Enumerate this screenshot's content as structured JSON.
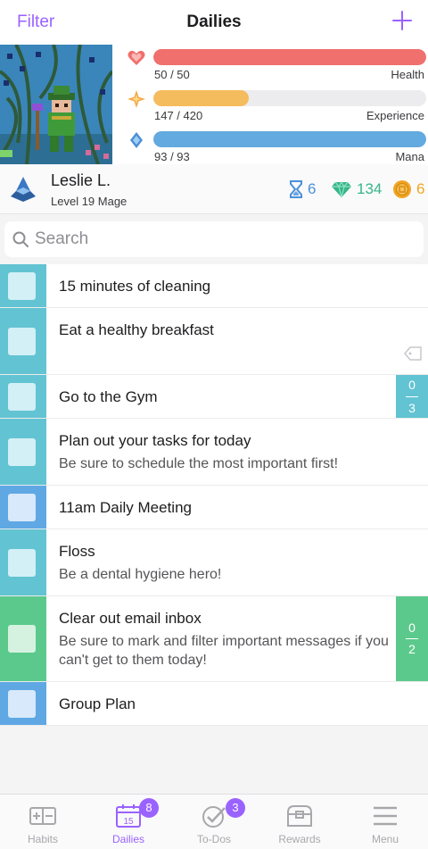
{
  "nav": {
    "filter_label": "Filter",
    "title": "Dailies",
    "add_icon": "plus-icon"
  },
  "stats": {
    "health": {
      "value_text": "50 / 50",
      "label": "Health",
      "fraction": 1.0,
      "color": "#f0706d",
      "icon": "heart-icon"
    },
    "experience": {
      "value_text": "147 / 420",
      "label": "Experience",
      "fraction": 0.35,
      "color": "#f5bc5e",
      "icon": "star-icon"
    },
    "mana": {
      "value_text": "93 / 93",
      "label": "Mana",
      "fraction": 1.0,
      "color": "#62aadf",
      "icon": "mana-drop-icon"
    }
  },
  "user": {
    "name": "Leslie L.",
    "level": "Level 19 Mage",
    "class_icon": "mage-class-icon",
    "hourglasses": "6",
    "gems": "134",
    "gold": "6"
  },
  "search": {
    "placeholder": "Search"
  },
  "tasks": [
    {
      "title": "15 minutes of cleaning",
      "note": "",
      "strip": "#62c3d2",
      "box": "#d2f0f5"
    },
    {
      "title": "Eat a healthy breakfast",
      "note": "",
      "strip": "#62c3d2",
      "box": "#d2f0f5",
      "has_tag": true
    },
    {
      "title": "Go to the Gym",
      "note": "",
      "strip": "#62c3d2",
      "box": "#d2f0f5",
      "counter": {
        "done": "0",
        "total": "3"
      }
    },
    {
      "title": "Plan out your tasks for today",
      "note": "Be sure to schedule the most important first!",
      "strip": "#62c3d2",
      "box": "#d2f0f5"
    },
    {
      "title": "11am Daily Meeting",
      "note": "",
      "strip": "#5fa8e4",
      "box": "#d7e9fb"
    },
    {
      "title": "Floss",
      "note": "Be a dental hygiene hero!",
      "strip": "#62c3d2",
      "box": "#d2f0f5"
    },
    {
      "title": "Clear out email inbox",
      "note": "Be sure to mark and filter important messages if you can't get to them today!",
      "strip": "#5cc98c",
      "box": "#d5f2e1",
      "counter": {
        "done": "0",
        "total": "2"
      }
    },
    {
      "title": "Group Plan",
      "note": "",
      "strip": "#5fa8e4",
      "box": "#d7e9fb"
    }
  ],
  "tabs": [
    {
      "label": "Habits",
      "icon": "habits-icon",
      "active": false
    },
    {
      "label": "Dailies",
      "icon": "calendar-icon",
      "active": true,
      "badge": "8",
      "icon_number": "15"
    },
    {
      "label": "To-Dos",
      "icon": "checkmark-icon",
      "active": false,
      "badge": "3"
    },
    {
      "label": "Rewards",
      "icon": "treasure-chest-icon",
      "active": false
    },
    {
      "label": "Menu",
      "icon": "hamburger-menu-icon",
      "active": false
    }
  ],
  "colors": {
    "accent": "#9a62ff",
    "hourglass": "#4a90d9",
    "gem": "#38b58a",
    "gold": "#f0a623"
  }
}
